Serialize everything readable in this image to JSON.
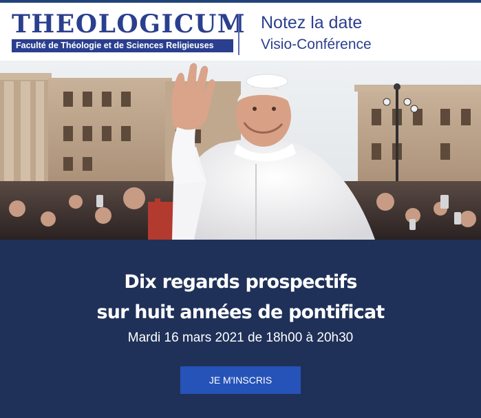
{
  "header": {
    "logo": {
      "wordmark": "THEOLOGICUM",
      "tagline": "Faculté de Théologie et de Sciences Religieuses"
    },
    "notice_title": "Notez la date",
    "notice_subtitle": "Visio-Conférence"
  },
  "event": {
    "title_line1": "Dix regards prospectifs",
    "title_line2": "sur huit années de pontificat",
    "date": "Mardi 16 mars 2021 de 18h00 à 20h30",
    "cta_label": "JE M'INSCRIS"
  },
  "colors": {
    "brand_blue": "#2b3f8f",
    "panel_navy": "#1f3158",
    "button_blue": "#2653b8"
  }
}
